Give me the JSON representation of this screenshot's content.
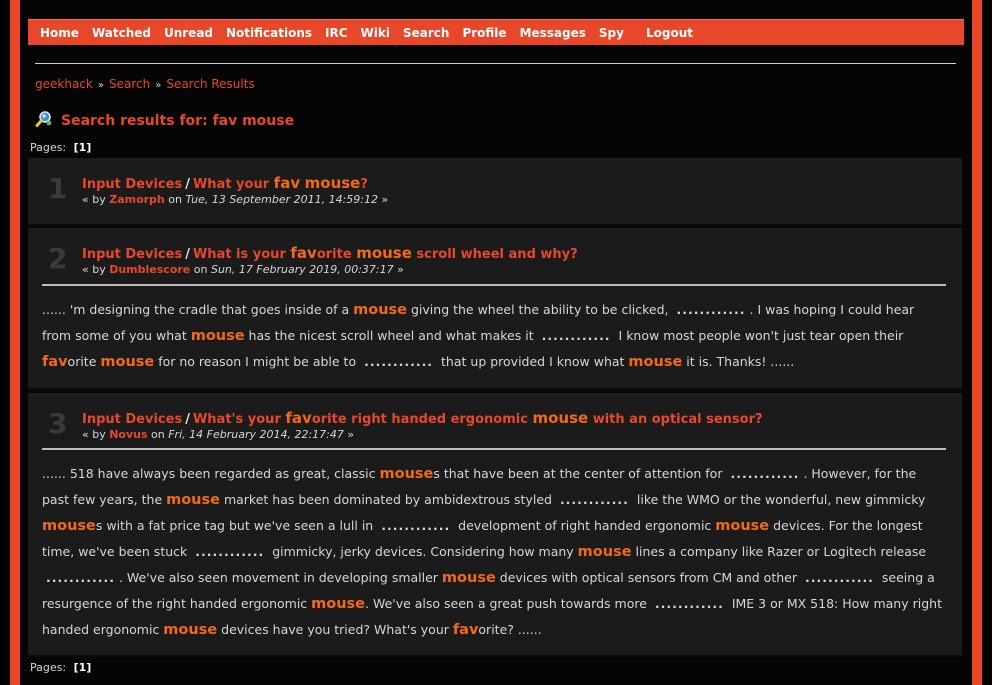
{
  "nav": {
    "items": [
      "Home",
      "Watched",
      "Unread",
      "Notifications",
      "IRC",
      "Wiki",
      "Search",
      "Profile",
      "Messages",
      "Spy"
    ],
    "logout": "Logout"
  },
  "breadcrumb": [
    "geekhack",
    "Search",
    "Search Results"
  ],
  "breadcrumb_sep": "»",
  "title": "Search results for: fav mouse",
  "pages_label": "Pages:",
  "pages_current": "[1]",
  "results": [
    {
      "num": "1",
      "board": "Input Devices",
      "topic": [
        "What your ",
        "fav",
        " ",
        "mouse",
        "?"
      ],
      "by": "« by",
      "author": "Zamorph",
      "on": "on",
      "date": "Tue, 13 September 2011, 14:59:12",
      "end": "»"
    },
    {
      "num": "2",
      "board": "Input Devices",
      "topic": [
        "What is your ",
        "fav",
        "orite ",
        "mouse",
        " scroll wheel and why?"
      ],
      "by": "« by",
      "author": "Dumblescore",
      "on": "on",
      "date": "Sun, 17 February 2019, 00:37:17",
      "end": "»",
      "body": [
        "...... 'm designing the cradle that goes inside of a ",
        "mouse",
        " giving the wheel the ability to be clicked, ",
        "............",
        ". I was hoping I could hear from some of you what ",
        "mouse",
        " has the nicest scroll wheel and what makes it ",
        "............",
        " I know most people won't just tear open their ",
        "fav",
        "orite ",
        "mouse",
        " for no reason I might be able to ",
        "............",
        " that up provided I know what ",
        "mouse",
        " it is.   Thanks! ......"
      ]
    },
    {
      "num": "3",
      "board": "Input Devices",
      "topic": [
        "What's your ",
        "fav",
        "orite right handed ergonomic ",
        "mouse",
        " with an optical sensor?"
      ],
      "by": "« by",
      "author": "Novus",
      "on": "on",
      "date": "Fri, 14 February 2014, 22:17:47",
      "end": "»",
      "body": [
        "......  518 have always been regarded as great, classic ",
        "mouse",
        "s that have been at the center of attention for ",
        "............",
        ". However, for the past few years, the ",
        "mouse",
        " market has been dominated by ambidextrous styled ",
        "............",
        " like the WMO or the wonderful, new gimmicky ",
        "mouse",
        "s with a fat price tag but we've seen a lull in ",
        "............",
        " development of right handed ergonomic ",
        "mouse",
        " devices.  For the longest time, we've been stuck ",
        "............",
        " gimmicky, jerky devices. Considering how many ",
        "mouse",
        " lines a company like Razer or Logitech release ",
        "............",
        ".   We've also seen movement in developing smaller ",
        "mouse",
        " devices with optical sensors from CM and other ",
        "............",
        " seeing a resurgence of the right handed ergonomic ",
        "mouse",
        ". We've also seen a great push towards more ",
        "............",
        " IME 3 or MX 518: How many right handed ergonomic ",
        "mouse",
        " devices have you tried? What's your ",
        "fav",
        "orite?  ......"
      ]
    }
  ]
}
